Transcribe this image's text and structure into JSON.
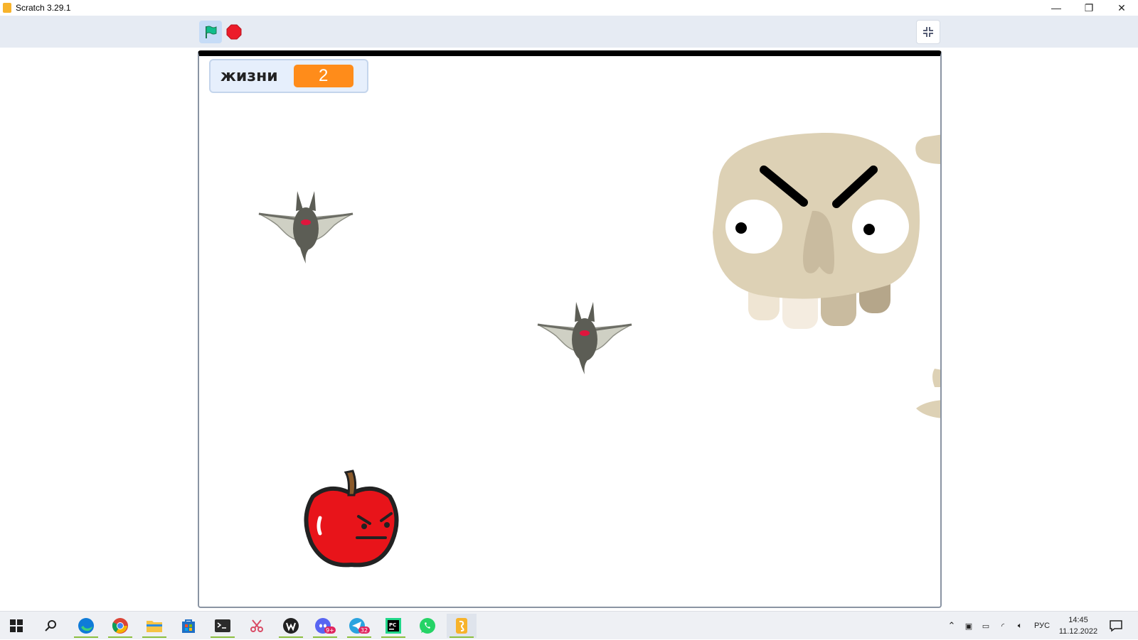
{
  "window": {
    "title": "Scratch 3.29.1",
    "minimize_symbol": "—",
    "restore_symbol": "❐",
    "close_symbol": "✕"
  },
  "toolbar": {
    "green_flag_icon": "green-flag-icon",
    "stop_icon": "stop-sign-icon",
    "unfullscreen_icon": "exit-fullscreen-icon"
  },
  "stage": {
    "variable_monitor": {
      "name": "жизни",
      "value": "2"
    },
    "sprites": [
      {
        "name": "bat",
        "count": 2
      },
      {
        "name": "skull",
        "count": 1
      },
      {
        "name": "angry-apple",
        "count": 1
      }
    ]
  },
  "taskbar": {
    "apps": [
      "start",
      "search",
      "edge",
      "chrome",
      "file-explorer",
      "microsoft-store",
      "terminal",
      "snipping-tool",
      "wakatime",
      "discord",
      "telegram",
      "pycharm",
      "whatsapp",
      "scratch"
    ],
    "badges": {
      "discord": "9+",
      "telegram": "32"
    },
    "language": "РУС",
    "time": "14:45",
    "date": "11.12.2022"
  },
  "colors": {
    "toolbar_bg": "#e6ebf3",
    "flag_green": "#0fbd8c",
    "stop_red": "#ec1c2a",
    "variable_orange": "#ff8c1a",
    "skull_beige": "#ddd1b5"
  }
}
